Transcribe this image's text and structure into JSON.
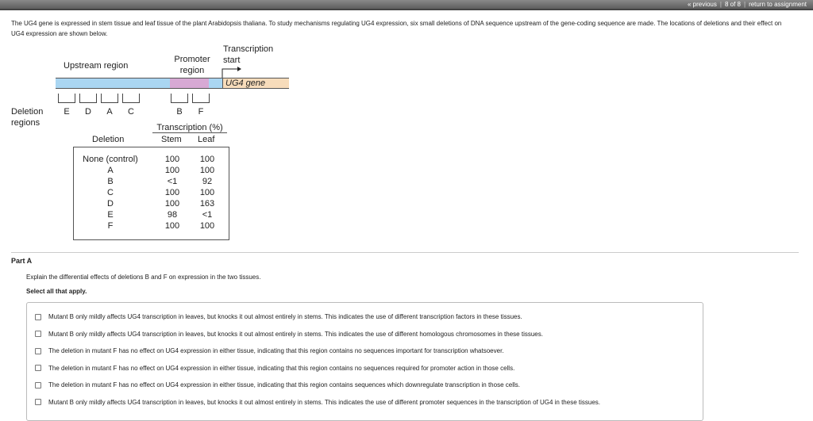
{
  "nav": {
    "previous": "« previous",
    "position": "8 of 8",
    "return": "return to assignment"
  },
  "intro": {
    "line": "The UG4 gene is expressed in stem tissue and leaf tissue of the plant Arabidopsis thaliana. To study mechanisms regulating UG4 expression, six small deletions of DNA sequence upstream of the gene-coding sequence are made. The locations of deletions and their effect on UG4 expression are shown below."
  },
  "diagram": {
    "upstream": "Upstream region",
    "promoter": "Promoter region",
    "tstart": "Transcription start",
    "gene": "UG4 gene",
    "deletion_regions": "Deletion regions",
    "regions": [
      "E",
      "D",
      "A",
      "C",
      "B",
      "F"
    ]
  },
  "table": {
    "title": "Transcription (%)",
    "col_deletion": "Deletion",
    "col_stem": "Stem",
    "col_leaf": "Leaf",
    "rows": [
      [
        "None (control)",
        "100",
        "100"
      ],
      [
        "A",
        "100",
        "100"
      ],
      [
        "B",
        "<1",
        "92"
      ],
      [
        "C",
        "100",
        "100"
      ],
      [
        "D",
        "100",
        "163"
      ],
      [
        "E",
        "98",
        "<1"
      ],
      [
        "F",
        "100",
        "100"
      ]
    ]
  },
  "part": {
    "title": "Part A",
    "question": "Explain the differential effects of deletions B and F on expression in the two tissues.",
    "instruction": "Select all that apply.",
    "options": [
      "Mutant B only mildly affects UG4 transcription in leaves, but knocks it out almost entirely in stems. This indicates the use of different transcription factors in these tissues.",
      "Mutant B only mildly affects UG4 transcription in leaves, but knocks it out almost entirely in stems. This indicates the use of different homologous chromosomes in these tissues.",
      "The deletion in mutant F has no effect on UG4 expression in either tissue, indicating that this region contains no sequences important for transcription whatsoever.",
      "The deletion in mutant F has no effect on UG4 expression in either tissue, indicating that this region contains no sequences required for promoter action in those cells.",
      "The deletion in mutant F has no effect on UG4 expression in either tissue, indicating that this region contains sequences which downregulate transcription in those cells.",
      "Mutant B only mildly affects UG4 transcription in leaves, but knocks it out almost entirely in stems. This indicates the use of different promoter sequences in the transcription of UG4 in these tissues."
    ]
  }
}
